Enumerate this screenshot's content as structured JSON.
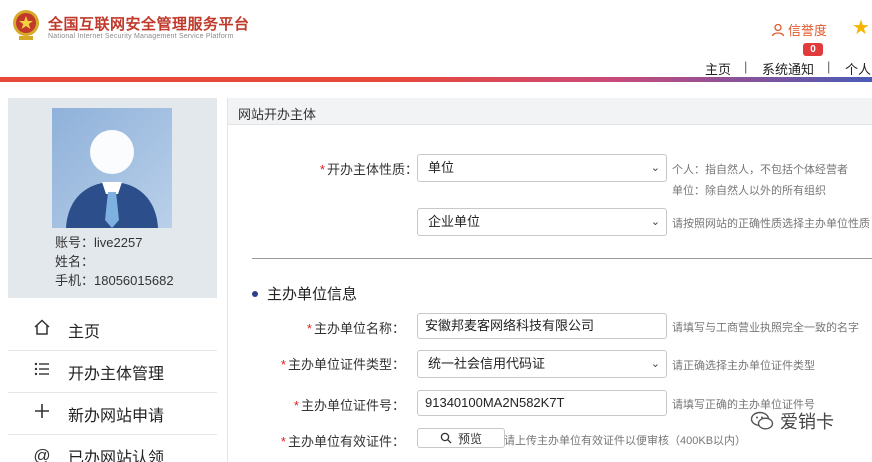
{
  "header": {
    "title": "全国互联网安全管理服务平台",
    "subtitle": "National Internet Security Management Service Platform",
    "credit_label": "信誉度",
    "notification_count": "0",
    "nav": [
      "主页",
      "系统通知",
      "个人中心"
    ],
    "nav_sep": "|"
  },
  "profile": {
    "account_label": "账号：",
    "account_value": "live2257",
    "name_label": "姓名：",
    "name_value": "",
    "phone_label": "手机：",
    "phone_value": "18056015682"
  },
  "sidebar": {
    "items": [
      {
        "label": "主页",
        "icon": "home-icon"
      },
      {
        "label": "开办主体管理",
        "icon": "list-icon"
      },
      {
        "label": "新办网站申请",
        "icon": "plus-icon"
      },
      {
        "label": "已办网站认领",
        "icon": "at-icon"
      }
    ]
  },
  "panel": {
    "title": "网站开办主体",
    "nature_label": "开办主体性质：",
    "nature_value": "单位",
    "nature_hint_1": "个人：指自然人，不包括个体经营者",
    "nature_hint_2": "单位：除自然人以外的所有组织",
    "unit_type_value": "企业单位",
    "unit_type_hint": "请按照网站的正确性质选择主办单位性质",
    "section_title": "主办单位信息",
    "org_name_label": "主办单位名称：",
    "org_name_value": "安徽邦麦客网络科技有限公司",
    "org_name_hint": "请填写与工商营业执照完全一致的名字",
    "cert_type_label": "主办单位证件类型：",
    "cert_type_value": "统一社会信用代码证",
    "cert_type_hint": "请正确选择主办单位证件类型",
    "cert_no_label": "主办单位证件号：",
    "cert_no_value": "91340100MA2N582K7T",
    "cert_no_hint": "请填写正确的主办单位证件号",
    "cert_valid_label": "主办单位有效证件：",
    "preview_label": "预览",
    "cert_valid_hint": "请上传主办单位有效证件以便审核（400KB以内）",
    "required_mark": "*"
  },
  "watermark": {
    "text": "爱销卡"
  },
  "colors": {
    "brand_red": "#c0392b",
    "accent_blue": "#2b3f8c",
    "required": "#e02020"
  }
}
